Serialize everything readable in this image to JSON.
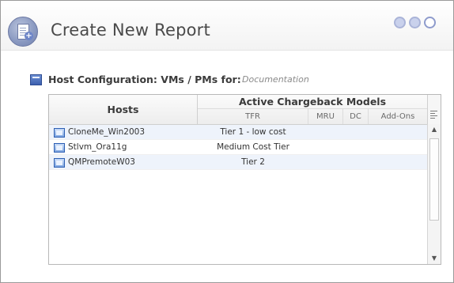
{
  "header": {
    "title": "Create New Report",
    "icon": "report-add-icon",
    "steps": [
      "step-1",
      "step-2",
      "step-3"
    ]
  },
  "section": {
    "label": "Host Configuration: VMs / PMs for:",
    "value": "Documentation"
  },
  "grid": {
    "hosts_header": "Hosts",
    "models_header": "Active Chargeback Models",
    "subcolumns": [
      "TFR",
      "MRU",
      "DC",
      "Add-Ons"
    ],
    "rows": [
      {
        "host": "CloneMe_Win2003",
        "tfr": "Tier 1 - low cost"
      },
      {
        "host": "Stlvm_Ora11g",
        "tfr": "Medium Cost Tier"
      },
      {
        "host": "QMPremoteW03",
        "tfr": "Tier 2"
      }
    ]
  },
  "colors": {
    "title_text": "#4a4a4a",
    "accent_blue": "#3c5fae",
    "row_alt_bg": "#eef3fb"
  }
}
